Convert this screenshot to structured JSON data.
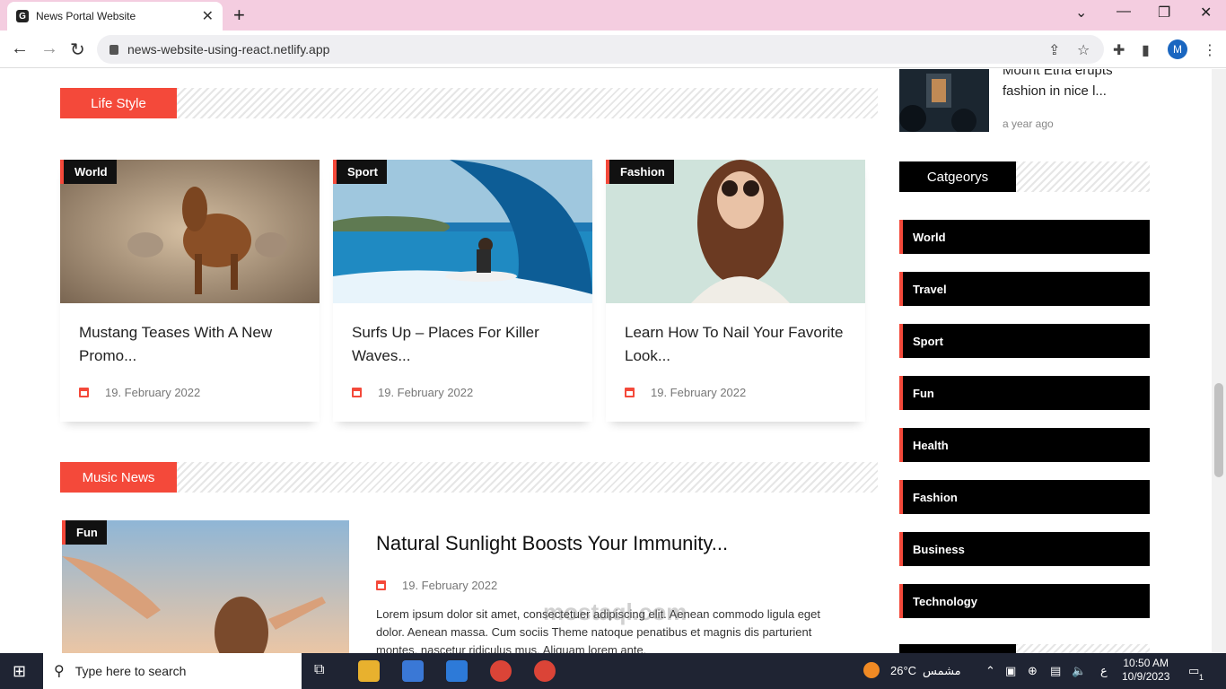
{
  "browser": {
    "tab_title": "News Portal Website",
    "url": "news-website-using-react.netlify.app",
    "profile_initial": "M"
  },
  "sidebar_post": {
    "title_line1": "Mount Etna erupts",
    "title_line2": "fashion in nice l...",
    "time": "a year ago"
  },
  "lifestyle": {
    "section_label": "Life Style",
    "cards": [
      {
        "badge": "World",
        "title": "Mustang Teases With A New Promo...",
        "date": "19. February 2022"
      },
      {
        "badge": "Sport",
        "title": "Surfs Up – Places For Killer Waves...",
        "date": "19. February 2022"
      },
      {
        "badge": "Fashion",
        "title": "Learn How To Nail Your Favorite Look...",
        "date": "19. February 2022"
      }
    ]
  },
  "music": {
    "section_label": "Music News",
    "badge": "Fun",
    "title": "Natural Sunlight Boosts Your Immunity...",
    "date": "19. February 2022",
    "excerpt": "Lorem ipsum dolor sit amet, consectetuer adipiscing elit. Aenean commodo ligula eget dolor. Aenean massa. Cum sociis Theme natoque penatibus et magnis dis parturient montes, nascetur ridiculus mus. Aliquam lorem ante,"
  },
  "categories": {
    "label": "Catgeorys",
    "items": [
      "World",
      "Travel",
      "Sport",
      "Fun",
      "Health",
      "Fashion",
      "Business",
      "Technology"
    ]
  },
  "taskbar": {
    "search_placeholder": "Type here to search",
    "weather": "26°C",
    "weather_label": "مشمس",
    "lang": "ع",
    "time": "10:50 AM",
    "date": "10/9/2023",
    "notifications": "1"
  },
  "watermark": "mostaql.com",
  "colors": {
    "accent": "#f4493a",
    "tabbar": "#f4cde0",
    "taskbar": "#1f2433"
  }
}
